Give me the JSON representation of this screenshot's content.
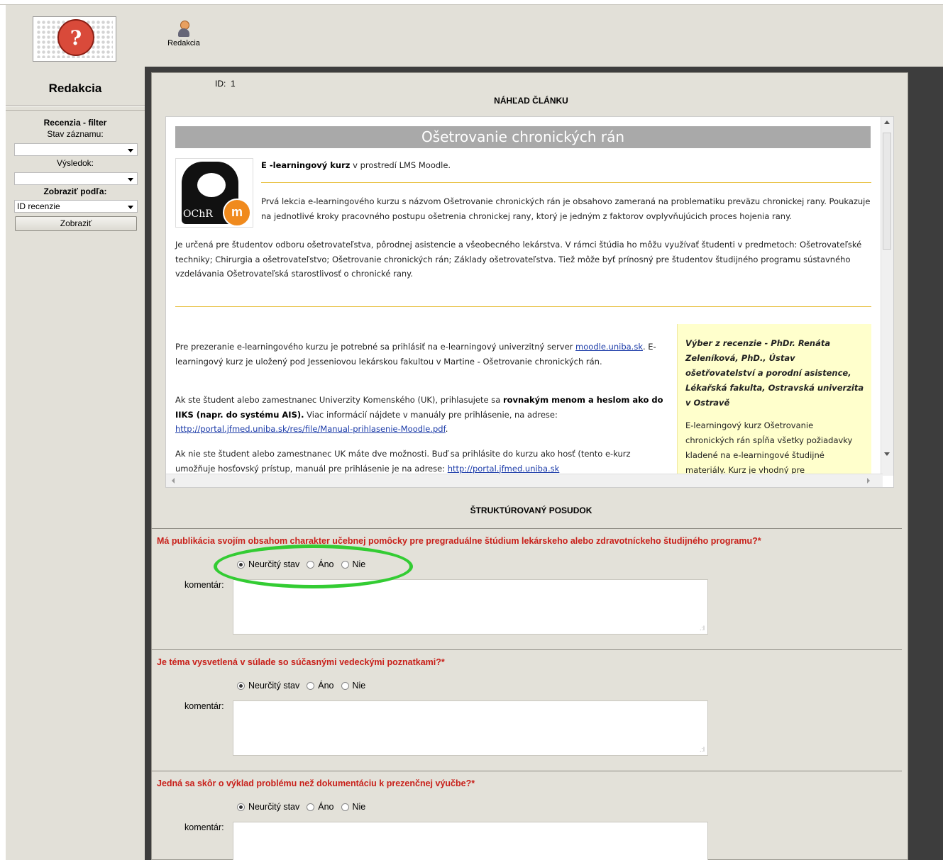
{
  "top": {
    "icon_label": "Redakcia"
  },
  "sidebar": {
    "title": "Redakcia",
    "filter_title": "Recenzia - filter",
    "filter_help": "?",
    "stav_label": "Stav záznamu:",
    "stav_value": "",
    "vysledok_label": "Výsledok:",
    "vysledok_value": "",
    "zobrazit_label": "Zobraziť podľa:",
    "zobrazit_value": "ID recenzie",
    "button": "Zobraziť"
  },
  "main": {
    "id_label": "ID:",
    "id_value": "1",
    "preview_title": "NÁHĽAD ČLÁNKU",
    "article": {
      "title": "Ošetrovanie chronických rán",
      "logo_text": "OChR",
      "lead_bold": "E -learningový kurz",
      "lead_rest": " v prostredí LMS Moodle.",
      "para1": "Prvá lekcia e-learningového kurzu s názvom Ošetrovanie chronických rán je obsahovo zameraná na problematiku preväzu chronickej rany. Poukazuje na jednotlivé kroky pracovného postupu ošetrenia chronickej rany, ktorý je jedným z faktorov ovplyvňujúcich proces hojenia rany.",
      "para2": "Je určená pre študentov odboru ošetrovateľstva, pôrodnej asistencie a všeobecného lekárstva. V rámci štúdia ho môžu využívať študenti v predmetoch: Ošetrovateľské techniky; Chirurgia a ošetrovateľstvo; Ošetrovanie chronických rán; Základy ošetrovateľstva. Tiež môže byť prínosný pre študentov študijného programu sústavného vzdelávania Ošetrovateľská starostlivosť o chronické rany.",
      "p3_a": "Pre prezeranie e-learningového kurzu je potrebné sa prihlásiť na e-learningový univerzitný server ",
      "p3_link": "moodle.uniba.sk",
      "p3_b": ". E-learningový kurz je uložený pod Jesseniovou lekárskou fakultou v Martine - Ošetrovanie chronických rán.",
      "p4_a": "Ak ste študent alebo zamestnanec Univerzity Komenského (UK), prihlasujete sa ",
      "p4_bold": "rovnakým menom a heslom ako do IIKS (napr. do systému AIS).",
      "p4_b": " Viac informácií nájdete v manuály pre prihlásenie, na adrese: ",
      "p4_link": "http://portal.jfmed.uniba.sk/res/file/Manual-prihlasenie-Moodle.pdf",
      "p4_c": ".",
      "p5_a": "Ak nie ste študent alebo zamestnanec UK máte dve možnosti. Buď sa prihlásite do kurzu ako hosť (tento e-kurz umožňuje hosťovský prístup, manuál pre prihlásenie je na adrese: ",
      "p5_link": "http://portal.jfmed.uniba.sk",
      "review_heading": "Výber z recenzie - PhDr. Renáta Zeleníková, PhD., Ústav ošetřovatelství a porodní asistence, Lékařská fakulta, Ostravská univerzita v Ostravě",
      "review_text": "E-learningový kurz Ošetrovanie chronických rán spĺňa všetky požiadavky kladené na e-learningové študijné materiály. Kurz je vhodný pre"
    },
    "structured_title": "ŠTRUKTÚROVANÝ POSUDOK",
    "comment_label": "komentár:",
    "options": [
      "Neurčitý stav",
      "Áno",
      "Nie"
    ],
    "questions": [
      "Má publikácia svojím obsahom charakter učebnej pomôcky pre pregraduálne štúdium lekárskeho alebo zdravotníckeho študijného programu?*",
      "Je téma vysvetlená v súlade so súčasnými vedeckými poznatkami?*",
      "Jedná sa skôr o výklad problému než dokumentáciu k prezenčnej výučbe?*"
    ]
  },
  "colors": {
    "question": "#c8201a",
    "highlight_ellipse": "#33cc33",
    "sidebar_bg": "#e2e0d8"
  }
}
